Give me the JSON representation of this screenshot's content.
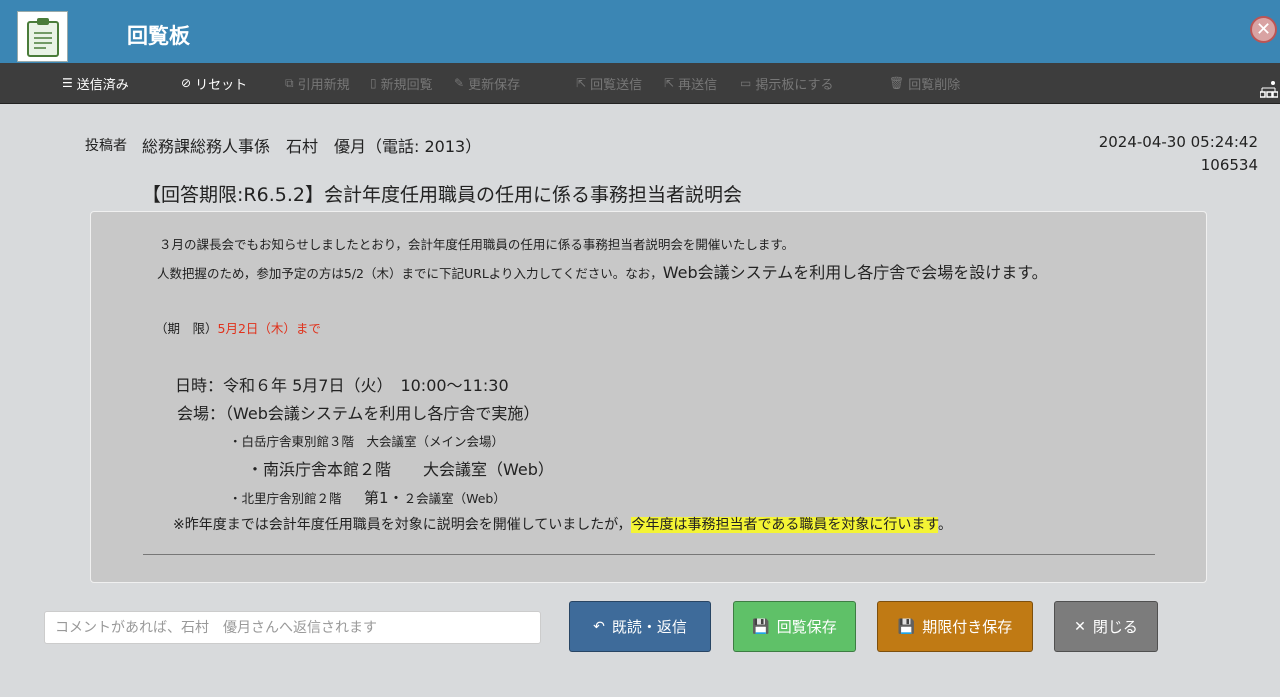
{
  "header": {
    "title": "回覧板",
    "logo_icon": "clipboard-icon",
    "close_icon": "close-icon"
  },
  "toolbar": {
    "items": [
      {
        "label": "送信済み",
        "icon": "list-icon",
        "active": true
      },
      {
        "label": "リセット",
        "icon": "no-entry-icon",
        "active": true
      },
      {
        "label": "引用新規",
        "icon": "copy-icon",
        "active": false
      },
      {
        "label": "新規回覧",
        "icon": "new-doc-icon",
        "active": false
      },
      {
        "label": "更新保存",
        "icon": "edit-icon",
        "active": false
      },
      {
        "label": "回覧送信",
        "icon": "share-icon",
        "active": false
      },
      {
        "label": "再送信",
        "icon": "share-icon",
        "active": false
      },
      {
        "label": "掲示板にする",
        "icon": "board-icon",
        "active": false
      },
      {
        "label": "回覧削除",
        "icon": "trash-icon",
        "active": false
      }
    ]
  },
  "meta": {
    "poster_label": "投稿者",
    "poster_name": "総務課総務人事係　石村　優月（電話: 2013）",
    "timestamp": "2024-04-30 05:24:42",
    "post_id": "106534",
    "subject": "【回答期限:R6.5.2】会計年度任用職員の任用に係る事務担当者説明会"
  },
  "body": {
    "line1": "３月の課長会でもお知らせしましたとおり，会計年度任用職員の任用に係る事務担当者説明会を開催いたします。",
    "line2a": "人数把握のため，参加予定の方は5/2（木）までに下記URLより入力してください。なお，",
    "line2b": "Web会議システムを利用し各庁舎で会場を設けます。",
    "deadline_label": "（期　限）",
    "deadline_value": "5月2日（木）まで",
    "datetime": "日時：令和６年 5月7日（火）　10:00〜11:30",
    "venue": "会場：（Web会議システムを利用し各庁舎で実施）",
    "venue1": "・白岳庁舎東別館３階　大会議室（メイン会場）",
    "venue2": "・南浜庁舎本館２階　　大会議室（Web）",
    "venue3a": "・北里庁舎別館２階　",
    "venue3b": "第1・",
    "venue3c": "２会議室（Web）",
    "note_a": "※昨年度までは会計年度任用職員を対象に説明会を開催していましたが，",
    "note_hl": "今年度は事務担当者である職員を対象に行います",
    "note_end": "。"
  },
  "actions": {
    "comment_placeholder": "コメントがあれば、石村　優月さんへ返信されます",
    "read_reply": "既読・返信",
    "save": "回覧保存",
    "save_deadline": "期限付き保存",
    "close": "閉じる"
  },
  "colors": {
    "header_bg": "#3b86b4",
    "toolbar_bg": "#3d3d3d",
    "deadline_red": "#e0321c",
    "highlight": "#f4f435",
    "btn_read": "#3e6b9a",
    "btn_save": "#5fc168",
    "btn_deadline": "#c07a14",
    "btn_close": "#7c7c7c"
  }
}
